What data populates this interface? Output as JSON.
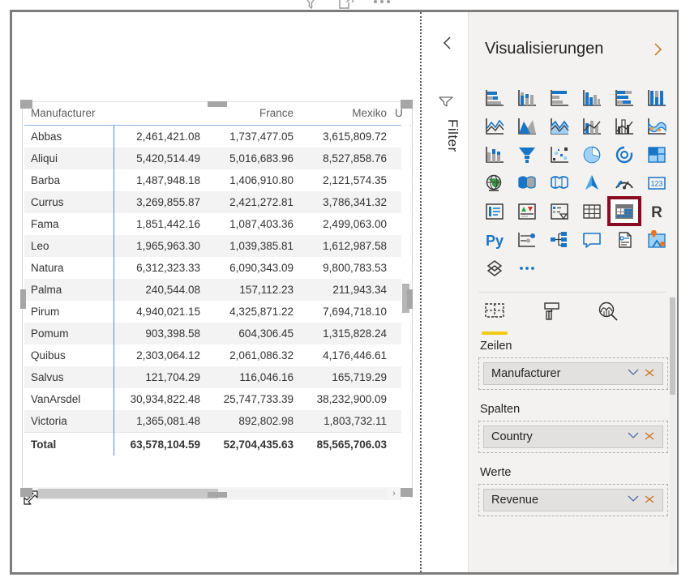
{
  "window": {},
  "visual_header": {
    "filter_icon": "funnel-icon",
    "focus_icon": "focus-mode-icon",
    "more_icon": "more-options-icon"
  },
  "matrix": {
    "row_header": "Manufacturer",
    "columns": [
      "Manufacturer",
      "",
      "France",
      "Mexiko",
      "U"
    ],
    "rows": [
      {
        "name": "Abbas",
        "values": [
          "2,461,421.08",
          "1,737,477.05",
          "3,615,809.72",
          ""
        ]
      },
      {
        "name": "Aliqui",
        "values": [
          "5,420,514.49",
          "5,016,683.96",
          "8,527,858.76",
          ""
        ]
      },
      {
        "name": "Barba",
        "values": [
          "1,487,948.18",
          "1,406,910.80",
          "2,121,574.35",
          ""
        ]
      },
      {
        "name": "Currus",
        "values": [
          "3,269,855.87",
          "2,421,272.81",
          "3,786,341.32",
          ""
        ]
      },
      {
        "name": "Fama",
        "values": [
          "1,851,442.16",
          "1,087,403.36",
          "2,499,063.00",
          ""
        ]
      },
      {
        "name": "Leo",
        "values": [
          "1,965,963.30",
          "1,039,385.81",
          "1,612,987.58",
          ""
        ]
      },
      {
        "name": "Natura",
        "values": [
          "6,312,323.33",
          "6,090,343.09",
          "9,800,783.53",
          ""
        ]
      },
      {
        "name": "Palma",
        "values": [
          "240,544.08",
          "157,112.23",
          "211,943.34",
          ""
        ]
      },
      {
        "name": "Pirum",
        "values": [
          "4,940,021.15",
          "4,325,871.22",
          "7,694,718.10",
          ""
        ]
      },
      {
        "name": "Pomum",
        "values": [
          "903,398.58",
          "604,306.45",
          "1,315,828.24",
          ""
        ]
      },
      {
        "name": "Quibus",
        "values": [
          "2,303,064.12",
          "2,061,086.32",
          "4,176,446.61",
          ""
        ]
      },
      {
        "name": "Salvus",
        "values": [
          "121,704.29",
          "116,046.16",
          "165,719.29",
          ""
        ]
      },
      {
        "name": "VanArsdel",
        "values": [
          "30,934,822.48",
          "25,747,733.39",
          "38,232,900.09",
          ""
        ]
      },
      {
        "name": "Victoria",
        "values": [
          "1,365,081.48",
          "892,802.98",
          "1,803,732.11",
          ""
        ]
      }
    ],
    "total": {
      "name": "Total",
      "values": [
        "63,578,104.59",
        "52,704,435.63",
        "85,565,706.03",
        ""
      ]
    },
    "scroll_left_arrow": "‹",
    "scroll_right_arrow": "›"
  },
  "filter_pane": {
    "collapse_icon": "chevron-left-icon",
    "funnel_icon": "filter-funnel-icon",
    "label": "Filter"
  },
  "viz_pane": {
    "title": "Visualisierungen",
    "expand_icon": "chevron-right-icon",
    "icons": [
      "stacked-bar-chart-icon",
      "stacked-column-chart-icon",
      "clustered-bar-chart-icon",
      "clustered-column-chart-icon",
      "100-percent-stacked-bar-chart-icon",
      "100-percent-stacked-column-chart-icon",
      "line-chart-icon",
      "area-chart-icon",
      "stacked-area-chart-icon",
      "line-and-stacked-column-chart-icon",
      "line-and-clustered-column-chart-icon",
      "ribbon-chart-icon",
      "waterfall-chart-icon",
      "funnel-chart-icon",
      "scatter-chart-icon",
      "pie-chart-icon",
      "donut-chart-icon",
      "treemap-icon",
      "map-icon",
      "filled-map-icon",
      "shape-map-icon",
      "azure-map-icon",
      "gauge-icon",
      "card-icon",
      "multi-row-card-icon",
      "kpi-icon",
      "slicer-icon",
      "table-icon",
      "matrix-icon",
      "r-script-visual-icon",
      "python-visual-icon",
      "key-influencers-icon",
      "decomposition-tree-icon",
      "q-and-a-icon",
      "smart-narrative-icon",
      "arcgis-maps-icon",
      "paginated-report-icon",
      "get-more-visuals-icon"
    ],
    "selected_icon": "matrix-icon",
    "selected_index": 28,
    "tabs": [
      {
        "name": "fields-tab",
        "icon": "fields-dashed-icon",
        "active": true
      },
      {
        "name": "format-tab",
        "icon": "paint-roller-icon",
        "active": false
      },
      {
        "name": "analytics-tab",
        "icon": "analytics-magnifier-icon",
        "active": false
      }
    ],
    "wells": [
      {
        "label": "Zeilen",
        "field": "Manufacturer",
        "dropdown_icon": "chevron-down-icon",
        "remove_icon": "close-icon"
      },
      {
        "label": "Spalten",
        "field": "Country",
        "dropdown_icon": "chevron-down-icon",
        "remove_icon": "close-icon"
      },
      {
        "label": "Werte",
        "field": "Revenue",
        "dropdown_icon": "chevron-down-icon",
        "remove_icon": "close-icon"
      }
    ]
  },
  "colors": {
    "accent_blue": "#4f8ede",
    "selection_red": "#8a0a24",
    "yellow_tab": "#f2c811",
    "pane_bg": "#f3f2f1",
    "alt_row": "#f3f3f3"
  }
}
